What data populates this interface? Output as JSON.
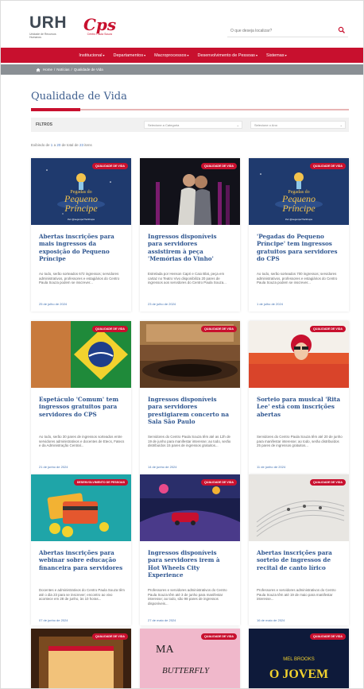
{
  "header": {
    "logo_main": "URH",
    "logo_sub": "Unidade de Recursos Humanos",
    "cps_logo": "Cps",
    "cps_sub": "Centro Paula Souza",
    "search_placeholder": "O que deseja localizar?"
  },
  "nav": {
    "items": [
      {
        "label": "Institucional"
      },
      {
        "label": "Departamentos"
      },
      {
        "label": "Macroprocessos"
      },
      {
        "label": "Desenvolvimento de Pessoas"
      },
      {
        "label": "Sistemas"
      }
    ]
  },
  "breadcrumb": {
    "home": "Home",
    "sep1": "/",
    "section": "Notícias",
    "sep2": "/",
    "current": "Qualidade de Vida"
  },
  "page": {
    "title": "Qualidade de Vida"
  },
  "filters": {
    "label": "FILTROS",
    "category_placeholder": "Selecione a Categoria",
    "year_placeholder": "Selecione o Ano"
  },
  "results": {
    "prefix": "Exibindo de",
    "from": "1",
    "mid1": "a",
    "to": "20",
    "mid2": "de total de",
    "total": "23",
    "suffix": "itens"
  },
  "cards": [
    {
      "badge": "QUALIDADE DE VIDA",
      "title": "Abertas inscrições para mais ingressos da exposição do Pequeno Príncipe",
      "desc": "Ao todo, serão sorteados 672 ingressos; servidores administrativos, professores e estagiários do Centro Paula Souza podem se inscrever...",
      "date": "25 de julho de 2024"
    },
    {
      "badge": "QUALIDADE DE VIDA",
      "title": "Ingressos disponíveis para servidores assistirem à peça 'Memórias do Vinho'",
      "desc": "Estrelada por Henson Capri e Caio Blat, peça em cartaz no Teatro Vivo disponibiliza 20 pares de ingressos aos servidores do Centro Paula Souza...",
      "date": "23 de julho de 2024"
    },
    {
      "badge": "QUALIDADE DE VIDA",
      "title": "'Pegadas do Pequeno Príncipe' tem ingressos gratuitos para servidores do CPS",
      "desc": "Ao todo, serão sorteados 700 ingressos; servidores administrativos, professores e estagiários do Centro Paula Souza podem se inscrever...",
      "date": "1 de julho de 2024"
    },
    {
      "badge": "QUALIDADE DE VIDA",
      "title": "Espetáculo 'Comum' tem ingressos gratuitos para servidores do CPS",
      "desc": "Ao todo, serão 30 pares de ingressos sorteados entre servidores administrativos e docentes de Etecs, Fatecs e da Administração Central...",
      "date": "21 de junho de 2024"
    },
    {
      "badge": "QUALIDADE DE VIDA",
      "title": "Ingressos disponíveis para servidores prestigiarem concerto na Sala São Paulo",
      "desc": "Servidores do Centro Paula Souza têm até as 12h de 19 de junho para manifestar interesse; ao todo, serão distribuídos 15 pares de ingressos gratuitos...",
      "date": "14 de junho de 2024"
    },
    {
      "badge": "QUALIDADE DE VIDA",
      "title": "Sorteio para musical 'Rita Lee' está com inscrições abertas",
      "desc": "Servidores do Centro Paula Souza têm até 20 de junho para manifestar interesse; ao todo, serão distribuídos 25 pares de ingressos gratuitos...",
      "date": "11 de junho de 2024"
    },
    {
      "badge": "DESENVOLVIMENTO DE PESSOAS",
      "title": "Abertas inscrições para webinar sobre educação financeira para servidores",
      "desc": "Docentes e administrativos do Centro Paula Souza têm até o dia 23 para se inscrever; encontro ao vivo acontece em 28 de junho, às 10 horas...",
      "date": "07 de junho de 2024"
    },
    {
      "badge": "QUALIDADE DE VIDA",
      "title": "Ingressos disponíveis para servidores irem à Hot Wheels City Experience",
      "desc": "Professores e servidores administrativos do Centro Paula Souza têm até 3 de junho para manifestar interesse; ao todo, são 98 pares de ingressos disponíveis...",
      "date": "27 de maio de 2024"
    },
    {
      "badge": "QUALIDADE DE VIDA",
      "title": "Abertas inscrições para sorteio de ingressos de recital de canto lírico",
      "desc": "Professores e servidores administrativos do Centro Paula Souza têm até 19 de maio para manifestar interesse...",
      "date": "16 de maio de 2024"
    },
    {
      "badge": "QUALIDADE DE VIDA"
    },
    {
      "badge": "QUALIDADE DE VIDA"
    },
    {
      "badge": "QUALIDADE DE VIDA"
    }
  ],
  "thumb_text": {
    "pp_title_a": "Pegadas do",
    "pp_title_b": "Pequeno",
    "pp_title_c": "Príncipe",
    "pp_hashtag": "#vc @segunpeTheShupa",
    "butterfly_a": "MA",
    "butterfly_b": "BUTTERFLY",
    "mel_a": "MEL BROOKS",
    "mel_b": "O JOVEM"
  },
  "colors": {
    "brand_red": "#c8102e",
    "title_blue": "#3f5f8f",
    "card_title_blue": "#2f5690",
    "crumb_gray": "#8a8f94"
  }
}
